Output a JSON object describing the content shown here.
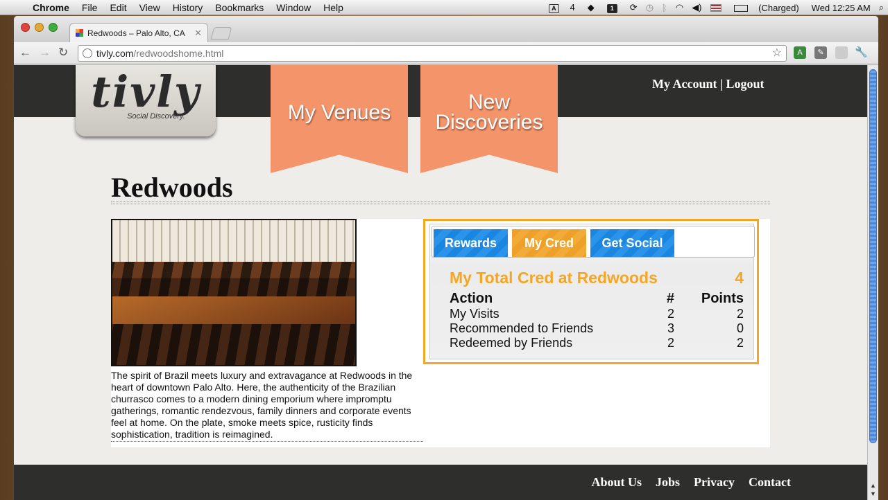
{
  "menubar": {
    "app": "Chrome",
    "items": [
      "File",
      "Edit",
      "View",
      "History",
      "Bookmarks",
      "Window",
      "Help"
    ],
    "adobe_count": "4",
    "battery": "(Charged)",
    "clock": "Wed 12:25 AM"
  },
  "browser": {
    "tab_title": "Redwoods – Palo Alto, CA",
    "url_host": "tivly.com",
    "url_path": "/redwoodshome.html"
  },
  "site": {
    "logo": "tivly",
    "tagline": "Social Discovery.",
    "nav": [
      "My Venues",
      "New Discoveries"
    ],
    "account": "My Account",
    "logout": "Logout",
    "separator": "|"
  },
  "venue": {
    "name": "Redwoods",
    "description": "The spirit of Brazil meets luxury and extravagance at Redwoods in the heart of downtown Palo Alto. Here, the authenticity of the Brazilian churrasco comes to a modern dining emporium where impromptu gatherings, romantic rendezvous, family dinners and corporate events feel at home. On the plate, smoke meets spice, rusticity finds sophistication, tradition is reimagined."
  },
  "panel": {
    "tabs": [
      "Rewards",
      "My Cred",
      "Get Social"
    ],
    "active_tab": "My Cred",
    "total_label": "My Total Cred at Redwoods",
    "total_value": "4",
    "headers": {
      "action": "Action",
      "count": "#",
      "points": "Points"
    },
    "rows": [
      {
        "action": "My Visits",
        "count": "2",
        "points": "2"
      },
      {
        "action": "Recommended to Friends",
        "count": "3",
        "points": "0"
      },
      {
        "action": "Redeemed by Friends",
        "count": "2",
        "points": "2"
      }
    ]
  },
  "footer": {
    "links": [
      "About Us",
      "Jobs",
      "Privacy",
      "Contact"
    ]
  },
  "colors": {
    "accent": "#f5a623",
    "ribbon": "#f4946a",
    "tab_blue": "#1a86e0",
    "header_bg": "#2e2e2c"
  }
}
